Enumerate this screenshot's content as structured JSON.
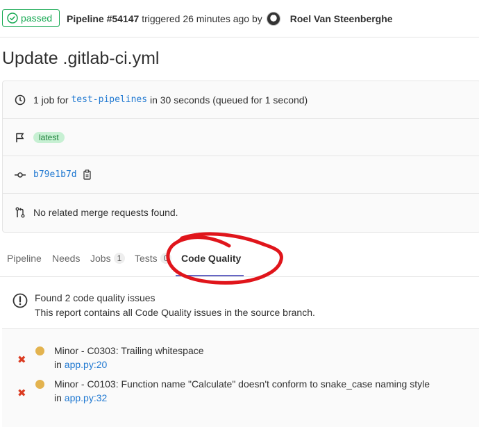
{
  "header": {
    "status_label": "passed",
    "pipeline_id": "Pipeline #54147",
    "triggered_text": "triggered 26 minutes ago by",
    "author": "Roel Van Steenberghe"
  },
  "title": "Update .gitlab-ci.yml",
  "info": {
    "jobs_prefix": "1 job for",
    "branch": "test-pipelines",
    "jobs_suffix": "in 30 seconds (queued for 1 second)",
    "badge": "latest",
    "commit_sha": "b79e1b7d",
    "merge_requests": "No related merge requests found."
  },
  "tabs": [
    {
      "label": "Pipeline"
    },
    {
      "label": "Needs"
    },
    {
      "label": "Jobs",
      "count": "1"
    },
    {
      "label": "Tests",
      "count": "0"
    },
    {
      "label": "Code Quality",
      "active": true
    }
  ],
  "summary": {
    "line1": "Found 2 code quality issues",
    "line2": "This report contains all Code Quality issues in the source branch."
  },
  "issues": [
    {
      "description": "Minor - C0303: Trailing whitespace",
      "in": "in",
      "location": "app.py:20"
    },
    {
      "description": "Minor - C0103: Function name \"Calculate\" doesn't conform to snake_case naming style",
      "in": "in",
      "location": "app.py:32"
    }
  ],
  "colors": {
    "passed": "#1aaa55",
    "link": "#1f78d1",
    "annotation": "#e0151b",
    "minor_dot": "#e3b34f",
    "failed_x": "#db3b21"
  }
}
